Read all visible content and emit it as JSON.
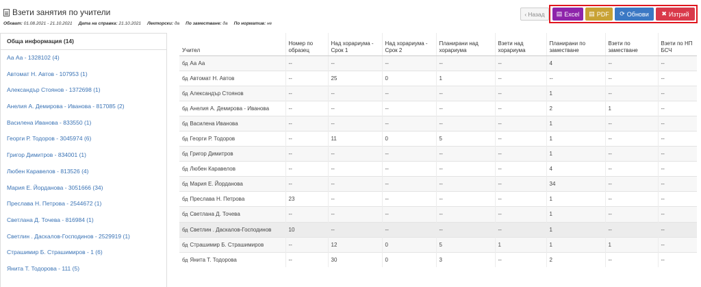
{
  "header": {
    "title": "Взети занятия по учители",
    "meta": [
      {
        "label": "Обхват:",
        "value": "01.08.2021 - 21.10.2021"
      },
      {
        "label": "Дата на справка:",
        "value": "21.10.2021"
      },
      {
        "label": "Лекторски:",
        "value": "да"
      },
      {
        "label": "По заместване:",
        "value": "да"
      },
      {
        "label": "По норматив:",
        "value": "не"
      }
    ]
  },
  "toolbar": {
    "back_label": "Назад",
    "excel_label": "Excel",
    "pdf_label": "PDF",
    "refresh_label": "Обнови",
    "clear_label": "Изтрий"
  },
  "colors": {
    "excel": "#8e24aa",
    "pdf": "#c8a234",
    "refresh": "#3b78c4",
    "clear": "#d9394a",
    "highlight_frame": "#e0161e",
    "link": "#3a73b5"
  },
  "sidebar": {
    "heading": "Обща информация (14)",
    "items": [
      "Аа Аа - 1328102 (4)",
      "Автомат Н. Автов - 107953 (1)",
      "Александър Стоянов - 1372698 (1)",
      "Анелия А. Демирова - Иванова - 817085 (2)",
      "Василена Иванова - 833550 (1)",
      "Георги Р. Тодоров - 3045974 (6)",
      "Григор Димитров - 834001 (1)",
      "Любен Каравелов - 813526 (4)",
      "Мария Е. Йорданова - 3051666 (34)",
      "Преслава Н. Петрова - 2544672 (1)",
      "Светлана Д. Точева - 816984 (1)",
      "Светлин . Даскалов-Господинов - 2529919 (1)",
      "Страшимир Б. Страшимиров - 1 (6)",
      "Янита Т. Тодорова - 111 (5)"
    ]
  },
  "table": {
    "columns": [
      "Учител",
      "Номер по образец",
      "Над хорариума - Срок 1",
      "Над хорариума - Срок 2",
      "Планирани над хорариума",
      "Взети над хорариума",
      "Планирани по заместване",
      "Взети по заместване",
      "Взети по НП БСЧ"
    ],
    "prefix": "бд",
    "rows": [
      [
        "Аа Аа",
        "--",
        "--",
        "--",
        "--",
        "--",
        "4",
        "--",
        "--"
      ],
      [
        "Автомат Н. Автов",
        "--",
        "25",
        "0",
        "1",
        "--",
        "--",
        "--",
        "--"
      ],
      [
        "Александър Стоянов",
        "--",
        "--",
        "--",
        "--",
        "--",
        "1",
        "--",
        "--"
      ],
      [
        "Анелия А. Демирова - Иванова",
        "--",
        "--",
        "--",
        "--",
        "--",
        "2",
        "1",
        "--"
      ],
      [
        "Василена Иванова",
        "--",
        "--",
        "--",
        "--",
        "--",
        "1",
        "--",
        "--"
      ],
      [
        "Георги Р. Тодоров",
        "--",
        "11",
        "0",
        "5",
        "--",
        "1",
        "--",
        "--"
      ],
      [
        "Григор Димитров",
        "--",
        "--",
        "--",
        "--",
        "--",
        "1",
        "--",
        "--"
      ],
      [
        "Любен Каравелов",
        "--",
        "--",
        "--",
        "--",
        "--",
        "4",
        "--",
        "--"
      ],
      [
        "Мария Е. Йорданова",
        "--",
        "--",
        "--",
        "--",
        "--",
        "34",
        "--",
        "--"
      ],
      [
        "Преслава Н. Петрова",
        "23",
        "--",
        "--",
        "--",
        "--",
        "1",
        "--",
        "--"
      ],
      [
        "Светлана Д. Точева",
        "--",
        "--",
        "--",
        "--",
        "--",
        "1",
        "--",
        "--"
      ],
      [
        "Светлин . Даскалов-Господинов",
        "10",
        "--",
        "--",
        "--",
        "--",
        "1",
        "--",
        "--"
      ],
      [
        "Страшимир Б. Страшимиров",
        "--",
        "12",
        "0",
        "5",
        "1",
        "1",
        "1",
        "--"
      ],
      [
        "Янита Т. Тодорова",
        "--",
        "30",
        "0",
        "3",
        "--",
        "2",
        "--",
        "--"
      ]
    ]
  }
}
